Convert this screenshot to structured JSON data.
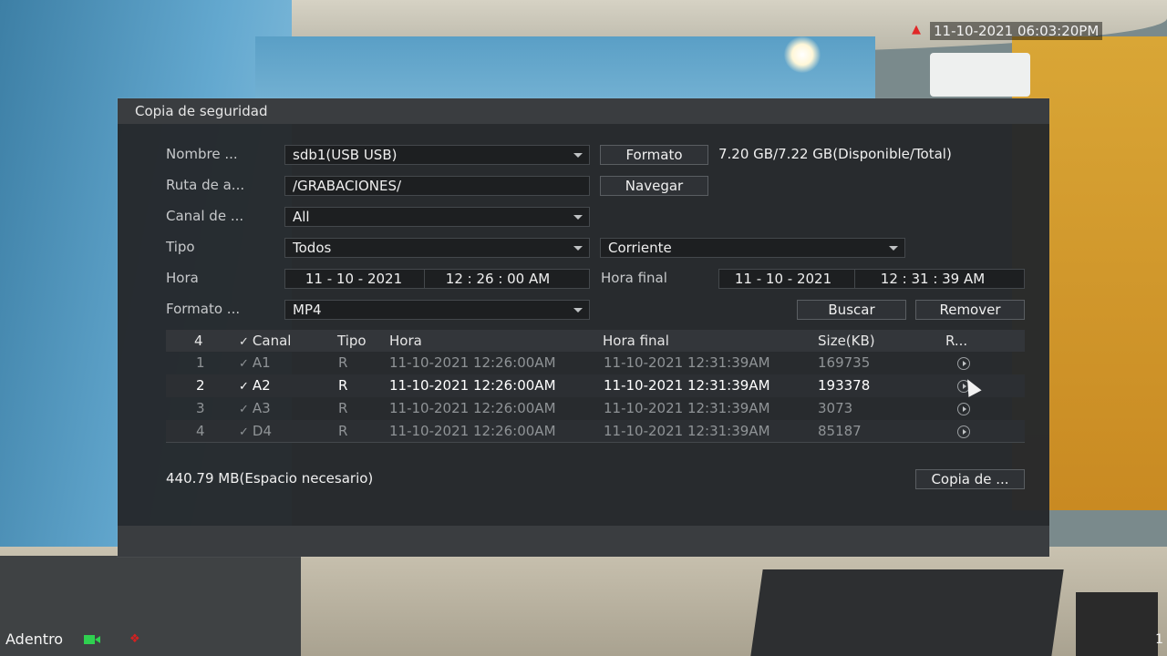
{
  "osd": {
    "timestamp": "11-10-2021 06:03:20PM",
    "channel_name": "Adentro",
    "edge_text": "1"
  },
  "dialog": {
    "title": "Copia de seguridad",
    "labels": {
      "device_name": "Nombre ...",
      "path": "Ruta de a...",
      "channel": "Canal de ...",
      "type": "Tipo",
      "time": "Hora",
      "end_time": "Hora final",
      "format": "Formato ..."
    },
    "device_value": "sdb1(USB USB)",
    "path_value": "/GRABACIONES/",
    "channel_value": "All",
    "type_value": "Todos",
    "stream_value": "Corriente",
    "start_date": "11 - 10 - 2021",
    "start_time": "12 : 26 : 00  AM",
    "end_date": "11 - 10 - 2021",
    "end_time": "12 : 31 : 39  AM",
    "format_value": "MP4",
    "capacity": "7.20 GB/7.22 GB(Disponible/Total)",
    "buttons": {
      "format": "Formato",
      "browse": "Navegar",
      "search": "Buscar",
      "remove": "Remover",
      "backup": "Copia de ..."
    },
    "space_needed": "440.79 MB(Espacio necesario)"
  },
  "table": {
    "headers": {
      "count": "4",
      "channel": "Canal",
      "type": "Tipo",
      "start": "Hora",
      "end": "Hora final",
      "size": "Size(KB)",
      "play": "R..."
    },
    "rows": [
      {
        "num": "1",
        "channel": "A1",
        "type": "R",
        "start": "11-10-2021 12:26:00AM",
        "end": "11-10-2021 12:31:39AM",
        "size": "169735"
      },
      {
        "num": "2",
        "channel": "A2",
        "type": "R",
        "start": "11-10-2021 12:26:00AM",
        "end": "11-10-2021 12:31:39AM",
        "size": "193378"
      },
      {
        "num": "3",
        "channel": "A3",
        "type": "R",
        "start": "11-10-2021 12:26:00AM",
        "end": "11-10-2021 12:31:39AM",
        "size": "3073"
      },
      {
        "num": "4",
        "channel": "D4",
        "type": "R",
        "start": "11-10-2021 12:26:00AM",
        "end": "11-10-2021 12:31:39AM",
        "size": "85187"
      }
    ]
  },
  "icons": {
    "alarm": "alarm-bell-icon",
    "record": "record-camera-icon",
    "motion": "motion-detect-icon",
    "play": "play-icon",
    "check": "check-icon",
    "cursor": "mouse-pointer-icon"
  }
}
